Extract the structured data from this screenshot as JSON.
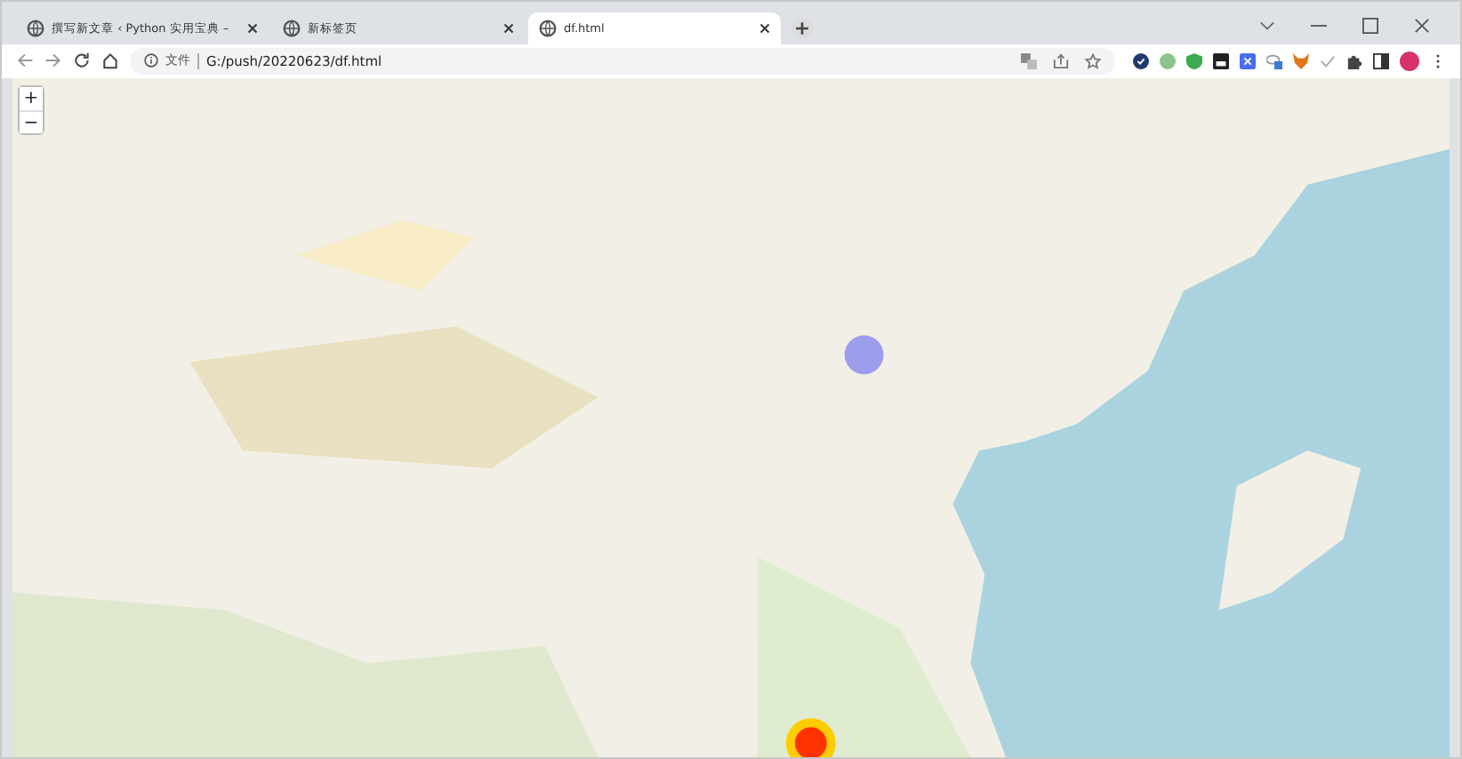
{
  "tabs": [
    {
      "title": "撰写新文章 ‹ Python 实用宝典 –",
      "selected": false
    },
    {
      "title": "新标签页",
      "selected": false
    },
    {
      "title": "df.html",
      "selected": true
    }
  ],
  "address": {
    "scheme_label": "文件",
    "url": "G:/push/20220623/df.html"
  },
  "map": {
    "zoom_buttons": [
      "+",
      "−"
    ]
  }
}
